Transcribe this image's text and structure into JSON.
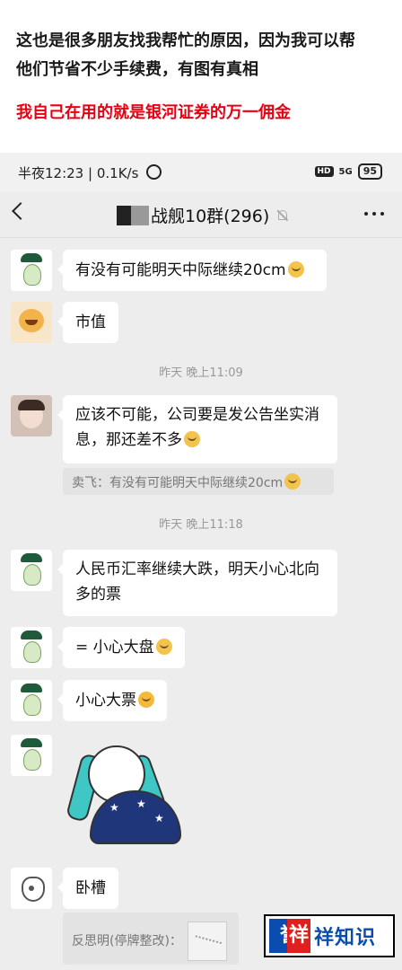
{
  "caption": {
    "line1a": "这也是很多朋友找我帮忙的原因，因为我可以帮",
    "line1b": "他们节省不少手续费，有图有真相",
    "line2": "我自己在用的就是银河证券的万一佣金"
  },
  "statusbar": {
    "time": "半夜12:23",
    "net_speed": "0.1K/s",
    "hd": "HD",
    "signal": "5G",
    "battery": "95"
  },
  "header": {
    "title": "战舰10群(296)"
  },
  "messages": [
    {
      "text": "有没有可能明天中际继续20cm"
    },
    {
      "text": "市值"
    },
    {
      "text": "应该不可能，公司要是发公告坐实消息，那还差不多"
    },
    {
      "text": "人民币汇率继续大跌，明天小心北向多的票"
    },
    {
      "text": "= 小心大盘"
    },
    {
      "text": "小心大票"
    },
    {
      "text": "卧槽"
    }
  ],
  "timestamps": [
    "昨天 晚上11:09",
    "昨天 晚上11:18"
  ],
  "quotes": [
    {
      "text": "卖飞：有没有可能明天中际继续20cm"
    },
    {
      "text": "反思明(停牌整改)："
    }
  ],
  "watermark": {
    "logo_a": "誉",
    "logo_b": "祥",
    "text": "祥知识"
  }
}
